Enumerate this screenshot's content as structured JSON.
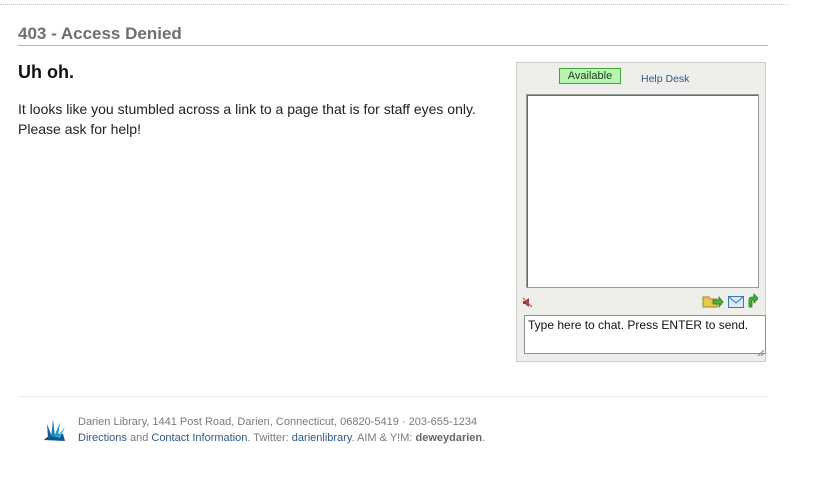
{
  "page": {
    "title": "403 - Access Denied",
    "heading": "Uh oh.",
    "message_line1": "It looks like you stumbled across a link to a page that is for staff eyes only.",
    "message_line2": "Please ask for help!"
  },
  "chat": {
    "status": "Available",
    "help_desk": "Help Desk",
    "input_placeholder": "Type here to chat. Press ENTER to send.",
    "icons": [
      "sound-off-icon",
      "send-file-icon",
      "email-icon",
      "popout-icon"
    ],
    "status_color": "#b8f5b0"
  },
  "footer": {
    "address": "Darien Library, 1441 Post Road, Darien, Connecticut, 06820-5419 · 203-655-1234",
    "directions_link": "Directions",
    "and_text": " and ",
    "contact_link": "Contact Information",
    "twitter_prefix": ". Twitter: ",
    "twitter_handle": "darienlibrary",
    "aim_prefix": ". AIM & Y!M: ",
    "aim_handle": "deweydarien",
    "end_period": ".",
    "link_color": "#2f5a86"
  }
}
